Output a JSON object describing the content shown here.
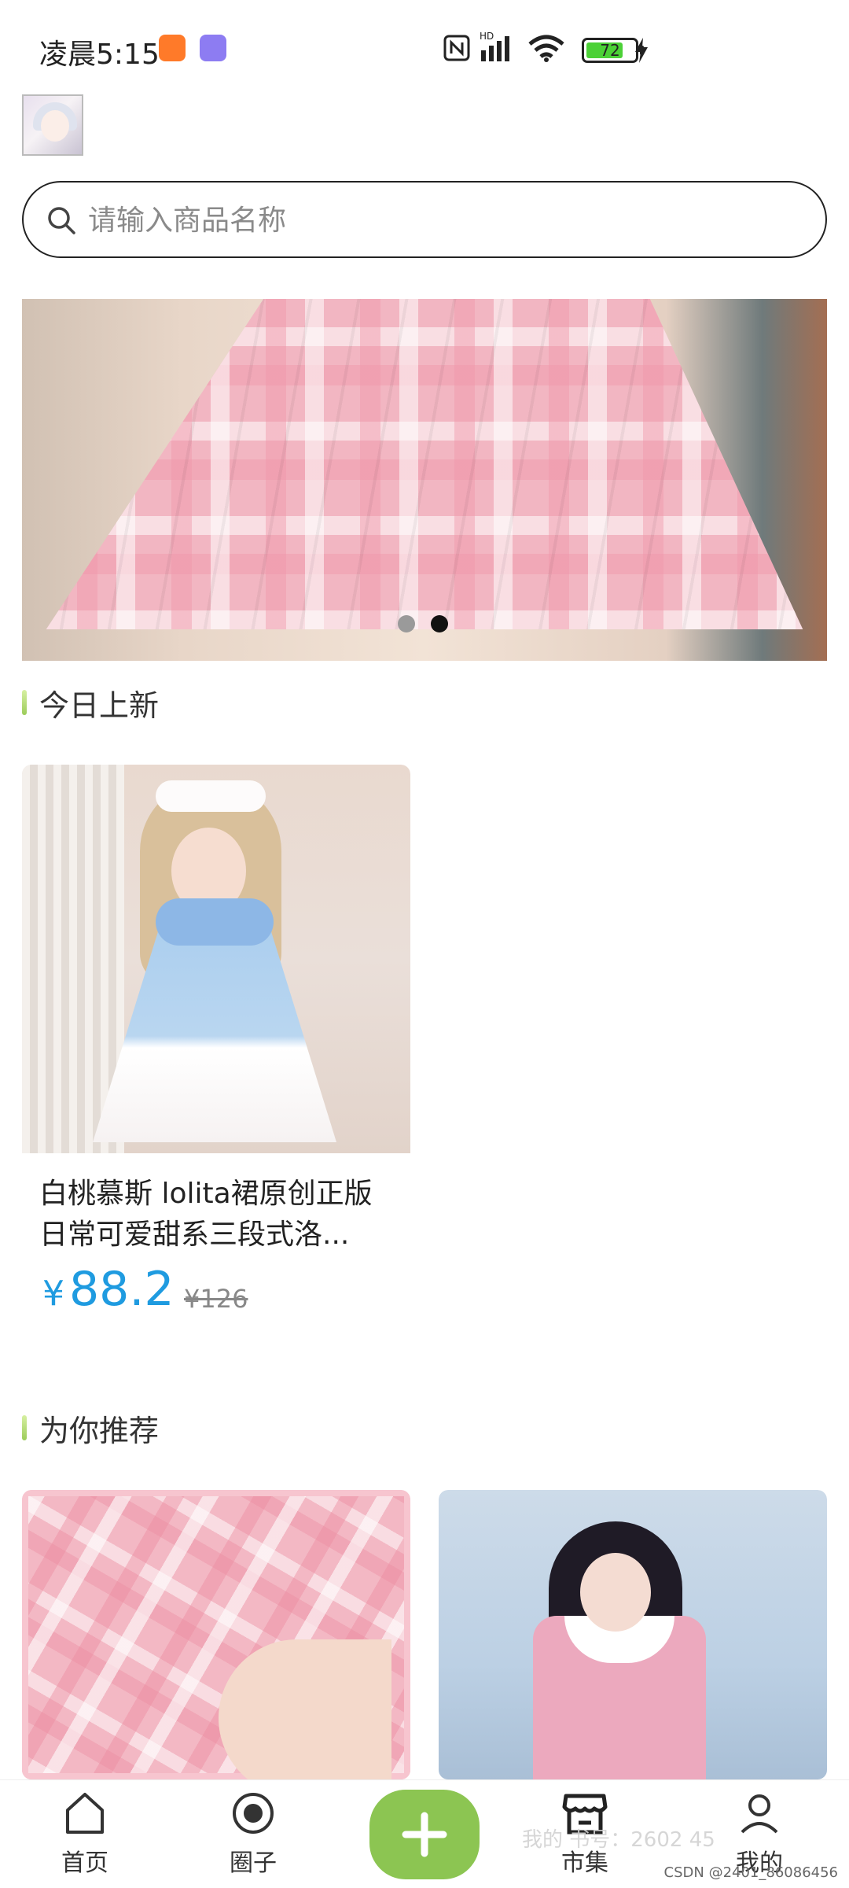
{
  "status_bar": {
    "time": "凌晨5:15",
    "battery": "72",
    "icons": [
      "app-orange-icon",
      "app-purple-icon",
      "nfc-icon",
      "hd-signal-icon",
      "wifi-icon",
      "battery-icon",
      "charging-icon"
    ]
  },
  "search": {
    "placeholder": "请输入商品名称"
  },
  "banner": {
    "slides": 2,
    "active_slide": 2
  },
  "section_new": {
    "title": "今日上新"
  },
  "new_products": [
    {
      "title": "白桃慕斯 lolita裙原创正版日常可爱甜系三段式洛...",
      "price_symbol": "¥",
      "price": "88.2",
      "original_price": "¥126"
    }
  ],
  "section_recommend": {
    "title": "为你推荐"
  },
  "bottom_nav": {
    "items": [
      {
        "label": "首页",
        "icon": "home-icon"
      },
      {
        "label": "圈子",
        "icon": "circle-icon"
      },
      {
        "label": "",
        "icon": "plus-icon"
      },
      {
        "label": "市集",
        "icon": "shop-icon"
      },
      {
        "label": "我的",
        "icon": "profile-icon"
      }
    ]
  },
  "watermark": "我的 书号：2602  45",
  "csdn": "CSDN @2401_86086456",
  "colors": {
    "accent_green": "#8cc552",
    "price_blue": "#1f9be0",
    "section_bar": "#9ccc5a"
  }
}
